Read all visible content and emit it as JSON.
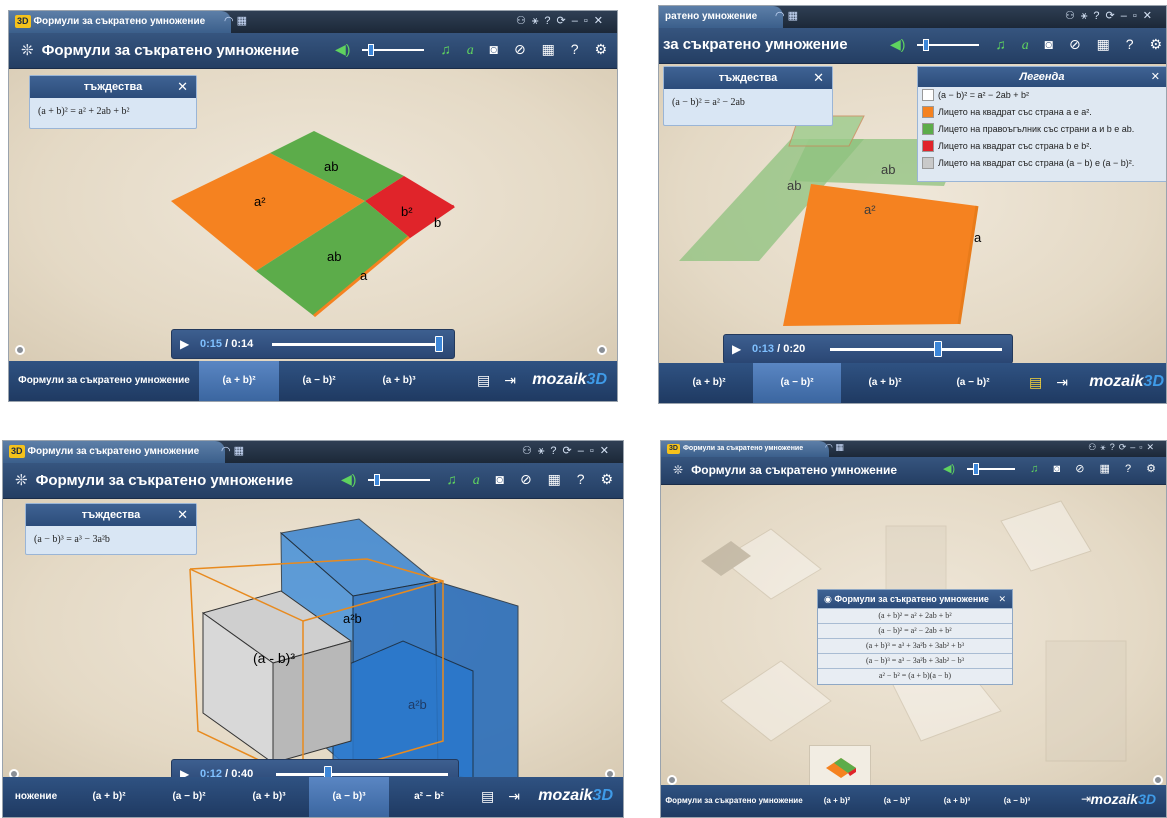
{
  "window_tab": {
    "logo": "3D",
    "title": "Формули за съкратено умножение"
  },
  "window_tab_cut": "ратено умножение",
  "app_title": "Формули за съкратено умножение",
  "app_title_cut": "за съкратено умножение",
  "colors": {
    "orange": "#f58220",
    "green": "#5cac4a",
    "red": "#e0242a",
    "white": "#ffffff",
    "gray": "#c9c9c9",
    "blue": "#2f7fd1",
    "titlebar": "#2c4a74",
    "accent_green": "#5fd35f"
  },
  "identities_box": {
    "title": "тъждества"
  },
  "panels": {
    "p1": {
      "formula": "(a + b)² = a² + 2ab + b²",
      "player": {
        "current": "0:15",
        "total": "0:14",
        "progress": 0.98
      },
      "labels": {
        "a2": "a²",
        "ab_top": "ab",
        "b2": "b²",
        "b_side": "b",
        "ab_bottom": "ab",
        "a_side": "a"
      },
      "tabs": [
        "Формули за съкратено умножение",
        "(a + b)²",
        "(a − b)²",
        "(a + b)³"
      ],
      "active_tab": 1
    },
    "p2": {
      "formula": "(a − b)² = a² − 2ab",
      "player": {
        "current": "0:13",
        "total": "0:20",
        "progress": 0.63
      },
      "labels": {
        "ab_left": "ab",
        "ab_right": "ab",
        "a2": "a²",
        "a_side": "a"
      },
      "legend": {
        "title": "Легенда",
        "items": [
          {
            "color": "#ffffff",
            "text": "(a − b)² = a² − 2ab + b²"
          },
          {
            "color": "#f58220",
            "text": "Лицето на квадрат със страна a е a²."
          },
          {
            "color": "#5cac4a",
            "text": "Лицето на правоъгълник със страни a и b е ab."
          },
          {
            "color": "#e0242a",
            "text": "Лицето на квадрат със страна b е b²."
          },
          {
            "color": "#c9c9c9",
            "text": "Лицето на квадрат със страна (a − b) е (a − b)²."
          }
        ]
      },
      "tabs": [
        "(a + b)²",
        "(a − b)²",
        "(a + b)²",
        "(a − b)²"
      ],
      "active_tab": 1
    },
    "p3": {
      "formula": "(a − b)³ = a³ − 3a²b",
      "player": {
        "current": "0:12",
        "total": "0:40",
        "progress": 0.3
      },
      "labels": {
        "cube": "(a - b)³",
        "a2b_top": "a²b",
        "a2b_side": "a²b"
      },
      "tabs": [
        "ножение",
        "(a + b)²",
        "(a − b)²",
        "(a + b)³",
        "(a − b)³",
        "a² − b²"
      ],
      "active_tab": 4
    },
    "p4": {
      "menu": {
        "title": "Формули за съкратено умножение",
        "items": [
          "(a + b)² = a² + 2ab + b²",
          "(a − b)² = a² − 2ab + b²",
          "(a + b)³ = a³ + 3a²b + 3ab² + b³",
          "(a − b)³ = a³ − 3a²b + 3ab² − b³",
          "a² − b² = (a + b)(a − b)"
        ]
      },
      "tabs": [
        "Формули за съкратено умножение",
        "(a + b)²",
        "(a − b)²",
        "(a + b)³",
        "(a − b)³"
      ],
      "active_tab": 0
    }
  },
  "brand": {
    "name": "mozaik",
    "suffix": "3D"
  },
  "icons": [
    "settings-icon",
    "help-icon",
    "camera-icon",
    "music-icon",
    "speaker-icon",
    "grid-icon",
    "link-icon",
    "document-icon",
    "exit-icon",
    "play-icon",
    "close-icon"
  ]
}
